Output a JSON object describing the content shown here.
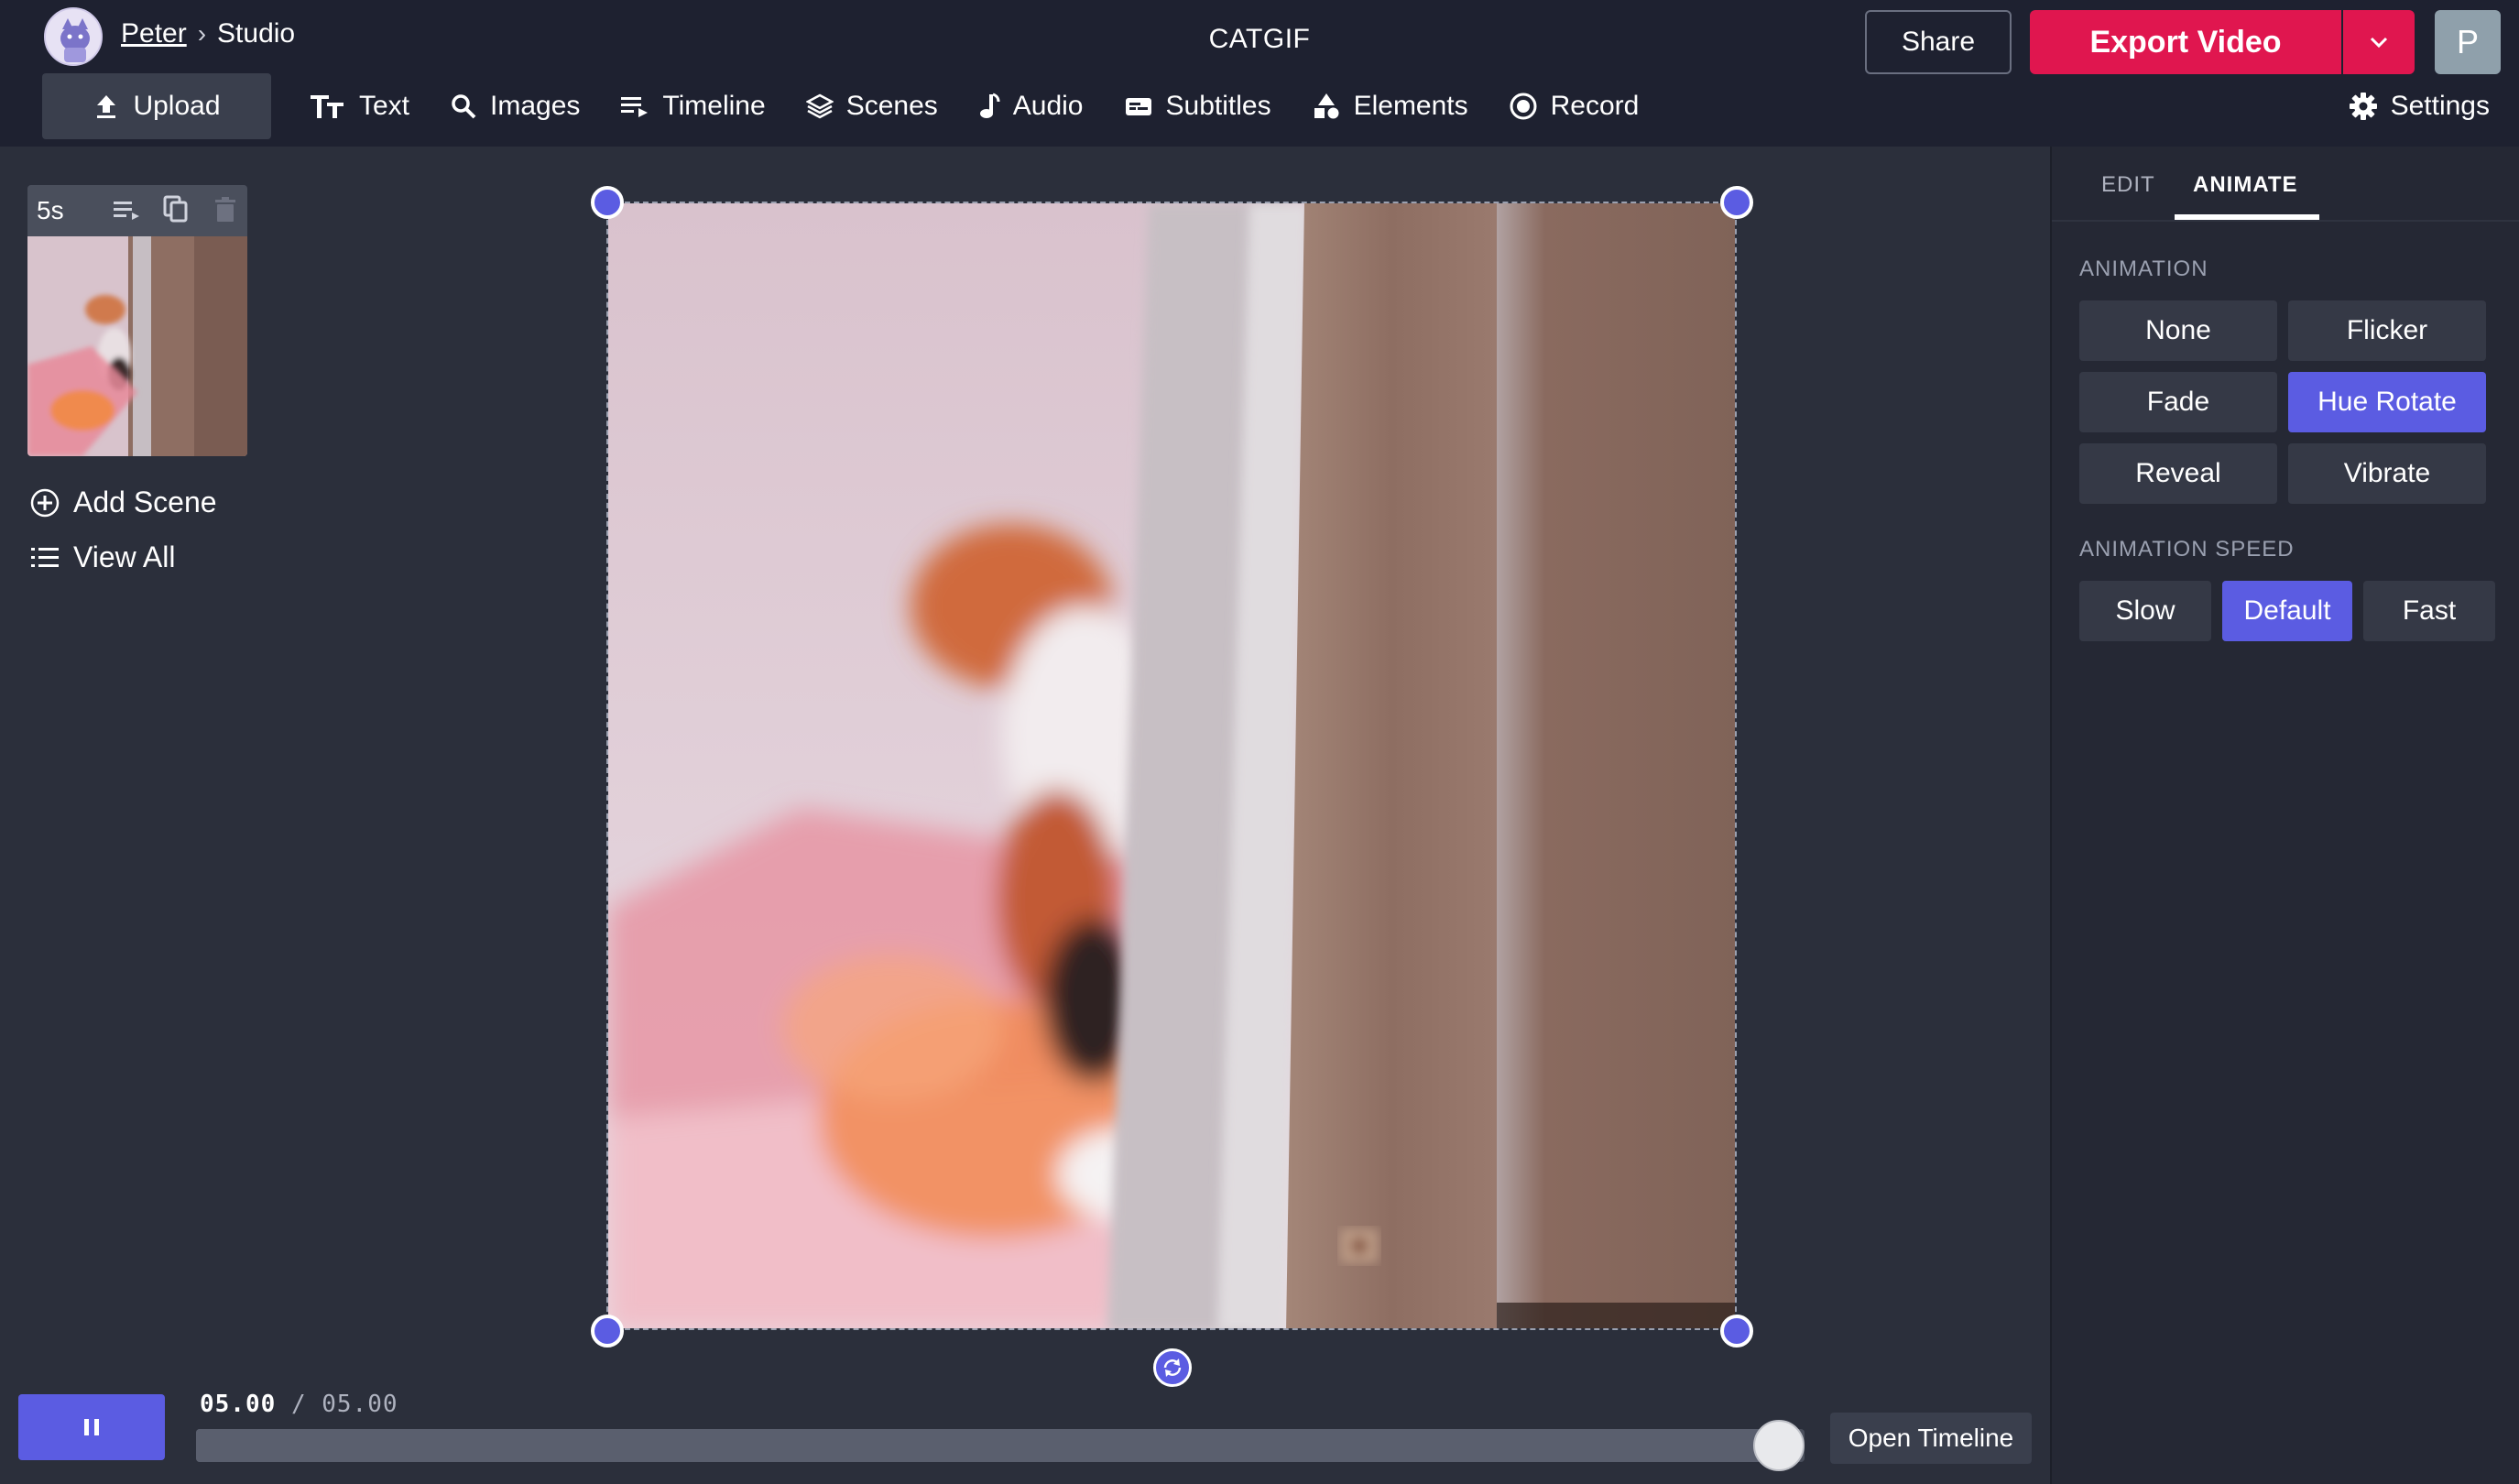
{
  "header": {
    "user": "Peter",
    "separator": "›",
    "section": "Studio",
    "project_title": "CATGIF",
    "share_label": "Share",
    "export_label": "Export Video",
    "profile_initial": "P"
  },
  "toolbar": {
    "items": [
      {
        "label": "Upload",
        "icon": "upload-icon"
      },
      {
        "label": "Text",
        "icon": "text-icon"
      },
      {
        "label": "Images",
        "icon": "search-icon"
      },
      {
        "label": "Timeline",
        "icon": "timeline-icon"
      },
      {
        "label": "Scenes",
        "icon": "layers-icon"
      },
      {
        "label": "Audio",
        "icon": "music-note-icon"
      },
      {
        "label": "Subtitles",
        "icon": "subtitles-icon"
      },
      {
        "label": "Elements",
        "icon": "shapes-icon"
      },
      {
        "label": "Record",
        "icon": "record-icon"
      }
    ],
    "settings_label": "Settings"
  },
  "scenes": {
    "items": [
      {
        "duration": "5s"
      }
    ],
    "add_scene_label": "Add Scene",
    "view_all_label": "View All"
  },
  "playback": {
    "current_time": "05.00",
    "separator": "/",
    "total_time": "05.00",
    "progress": 1.0,
    "open_timeline_label": "Open Timeline"
  },
  "right_panel": {
    "tabs": [
      {
        "label": "EDIT",
        "active": false
      },
      {
        "label": "ANIMATE",
        "active": true
      }
    ],
    "animation_label": "ANIMATION",
    "animations": [
      {
        "label": "None",
        "active": false
      },
      {
        "label": "Flicker",
        "active": false
      },
      {
        "label": "Fade",
        "active": false
      },
      {
        "label": "Hue Rotate",
        "active": true
      },
      {
        "label": "Reveal",
        "active": false
      },
      {
        "label": "Vibrate",
        "active": false
      }
    ],
    "speed_label": "ANIMATION SPEED",
    "speeds": [
      {
        "label": "Slow",
        "active": false
      },
      {
        "label": "Default",
        "active": true
      },
      {
        "label": "Fast",
        "active": false
      }
    ]
  },
  "colors": {
    "accent": "#5b5ce2",
    "export": "#e0164f",
    "topbar": "#1e2130",
    "canvas_bg": "#2b2f3b",
    "panel_bg": "#252834"
  }
}
